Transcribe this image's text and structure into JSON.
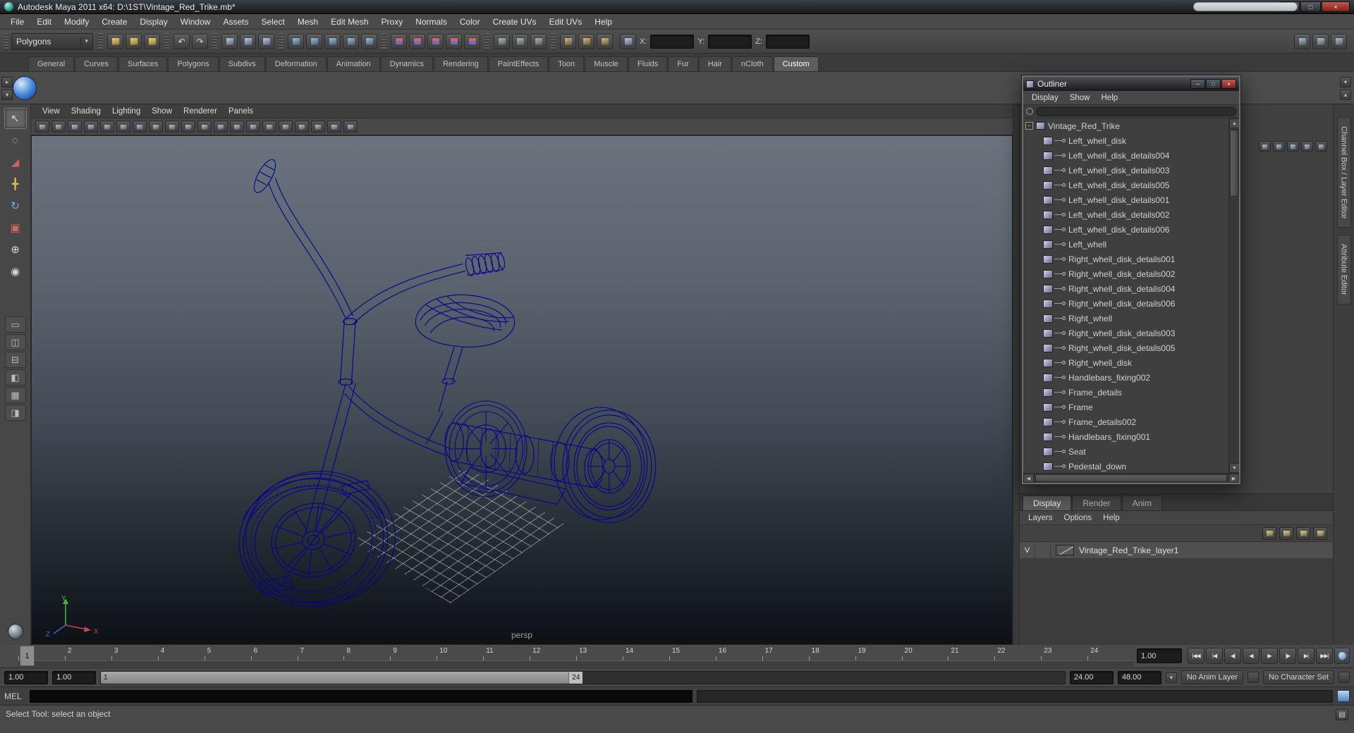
{
  "titlebar": {
    "title": "Autodesk Maya 2011 x64: D:\\1ST\\Vintage_Red_Trike.mb*"
  },
  "menubar": [
    "File",
    "Edit",
    "Modify",
    "Create",
    "Display",
    "Window",
    "Assets",
    "Select",
    "Mesh",
    "Edit Mesh",
    "Proxy",
    "Normals",
    "Color",
    "Create UVs",
    "Edit UVs",
    "Help"
  ],
  "statusline": {
    "mode_selector": "Polygons",
    "groups": [
      {
        "cls": "g-file",
        "icons": [
          {
            "n": "new-scene-icon"
          },
          {
            "n": "open-scene-icon"
          },
          {
            "n": "save-scene-icon"
          }
        ]
      },
      {
        "cls": "g-undo",
        "icons": [
          {
            "n": "undo-icon",
            "g": "↶"
          },
          {
            "n": "redo-icon",
            "g": "↷"
          }
        ]
      },
      {
        "cls": "g-mode",
        "icons": [
          {
            "n": "select-hierarchy-icon"
          },
          {
            "n": "select-object-icon"
          },
          {
            "n": "select-component-icon"
          }
        ]
      },
      {
        "cls": "g-mask",
        "icons": [
          {
            "n": "select-handles-icon"
          },
          {
            "n": "select-points-icon"
          },
          {
            "n": "select-curves-icon"
          },
          {
            "n": "select-surfaces-icon"
          },
          {
            "n": "select-rendering-icon"
          }
        ]
      },
      {
        "cls": "g-snap",
        "icons": [
          {
            "n": "snap-to-grids-icon"
          },
          {
            "n": "snap-to-curves-icon"
          },
          {
            "n": "snap-to-points-icon"
          },
          {
            "n": "snap-to-view-planes-icon"
          },
          {
            "n": "make-live-icon"
          }
        ]
      },
      {
        "cls": "g-hist",
        "icons": [
          {
            "n": "input-connections-icon"
          },
          {
            "n": "output-connections-icon"
          },
          {
            "n": "construction-history-icon"
          }
        ]
      },
      {
        "cls": "g-render",
        "icons": [
          {
            "n": "render-current-frame-icon"
          },
          {
            "n": "ipr-render-icon"
          },
          {
            "n": "render-settings-icon"
          }
        ]
      }
    ],
    "coord": {
      "x_label": "X:",
      "y_label": "Y:",
      "z_label": "Z:",
      "x_value": "",
      "y_value": "",
      "z_value": ""
    },
    "right_icons": [
      {
        "n": "show-channel-box-icon"
      },
      {
        "n": "show-tool-settings-icon"
      },
      {
        "n": "show-attribute-editor-icon"
      }
    ]
  },
  "shelf": {
    "tabs": [
      "General",
      "Curves",
      "Surfaces",
      "Polygons",
      "Subdivs",
      "Deformation",
      "Animation",
      "Dynamics",
      "Rendering",
      "PaintEffects",
      "Toon",
      "Muscle",
      "Fluids",
      "Fur",
      "Hair",
      "nCloth",
      "Custom"
    ],
    "active_tab": "Custom"
  },
  "toolbox": {
    "tools": [
      {
        "n": "select-tool",
        "g": "↖"
      },
      {
        "n": "lasso-select-tool",
        "g": "◌"
      },
      {
        "n": "paint-select-tool",
        "g": "◢"
      },
      {
        "n": "move-tool",
        "g": "╋"
      },
      {
        "n": "rotate-tool",
        "g": "↻"
      },
      {
        "n": "scale-tool",
        "g": "▣"
      },
      {
        "n": "universal-manipulator-tool",
        "g": "⊕"
      },
      {
        "n": "soft-modification-tool",
        "g": "◉"
      }
    ],
    "active_tool": "select-tool",
    "layouts": [
      {
        "n": "single-pane-layout",
        "g": "▭"
      },
      {
        "n": "two-panes-side-by-side-layout",
        "g": "◫"
      },
      {
        "n": "two-panes-stacked-layout",
        "g": "⊟"
      },
      {
        "n": "three-panes-layout",
        "g": "◧"
      },
      {
        "n": "four-panes-layout",
        "g": "▦"
      },
      {
        "n": "outliner-persp-layout",
        "g": "◨"
      }
    ]
  },
  "viewport": {
    "menus": [
      "View",
      "Shading",
      "Lighting",
      "Show",
      "Renderer",
      "Panels"
    ],
    "toolbar_icons": [
      "select-camera-icon",
      "camera-attributes-icon",
      "bookmark-icon",
      "image-plane-icon",
      "view-grid-icon",
      "film-gate-icon",
      "resolution-gate-icon",
      "gate-mask-icon",
      "field-chart-icon",
      "safe-action-icon",
      "safe-title-icon",
      "wireframe-mode-icon",
      "shaded-mode-icon",
      "textured-mode-icon",
      "use-all-lights-icon",
      "shadows-icon",
      "xray-icon",
      "isolate-select-icon",
      "frame-selected-icon",
      "frame-all-icon"
    ],
    "camera_label": "persp",
    "axis": {
      "x": "X",
      "y": "Y",
      "z": "Z"
    }
  },
  "outliner": {
    "title": "Outliner",
    "menus": [
      "Display",
      "Show",
      "Help"
    ],
    "root_item": "Vintage_Red_Trike",
    "items": [
      "Left_whell_disk",
      "Left_whell_disk_details004",
      "Left_whell_disk_details003",
      "Left_whell_disk_details005",
      "Left_whell_disk_details001",
      "Left_whell_disk_details002",
      "Left_whell_disk_details006",
      "Left_whell",
      "Right_whell_disk_details001",
      "Right_whell_disk_details002",
      "Right_whell_disk_details004",
      "Right_whell_disk_details006",
      "Right_whell",
      "Right_whell_disk_details003",
      "Right_whell_disk_details005",
      "Right_whell_disk",
      "Handlebars_fixing002",
      "Frame_details",
      "Frame",
      "Frame_details002",
      "Handlebars_fixing001",
      "Seat",
      "Pedestal_down"
    ]
  },
  "layer_editor": {
    "tabs": [
      "Display",
      "Render",
      "Anim"
    ],
    "active_tab": "Display",
    "menus": [
      "Layers",
      "Options",
      "Help"
    ],
    "icons": [
      "layers-options-icon",
      "transfer-attributes-icon",
      "new-empty-layer-icon",
      "new-layer-from-selected-icon"
    ],
    "layers": [
      {
        "visibility": "V",
        "name": "Vintage_Red_Trike_layer1"
      }
    ]
  },
  "right_tabs": [
    "Channel Box / Layer Editor",
    "Attribute Editor"
  ],
  "channel_box_icons": [
    "channel-manipulator-icon",
    "channel-speed-slow-icon",
    "channel-speed-medium-icon",
    "channel-speed-fast-icon",
    "channel-clamp-icon"
  ],
  "time_slider": {
    "ticks": [
      "1",
      "2",
      "3",
      "4",
      "5",
      "6",
      "7",
      "8",
      "9",
      "10",
      "11",
      "12",
      "13",
      "14",
      "15",
      "16",
      "17",
      "18",
      "19",
      "20",
      "21",
      "22",
      "23",
      "24"
    ],
    "current_frame": "1",
    "current_time": "1.00",
    "transport": [
      {
        "n": "go-to-start-button",
        "g": "|◀◀"
      },
      {
        "n": "step-back-one-key-button",
        "g": "|◀"
      },
      {
        "n": "step-back-one-frame-button",
        "g": "◀|"
      },
      {
        "n": "play-backwards-button",
        "g": "◀"
      },
      {
        "n": "play-forwards-button",
        "g": "▶"
      },
      {
        "n": "step-forward-one-frame-button",
        "g": "|▶"
      },
      {
        "n": "step-forward-one-key-button",
        "g": "▶|"
      },
      {
        "n": "go-to-end-button",
        "g": "▶▶|"
      }
    ]
  },
  "range_slider": {
    "anim_start": "1.00",
    "playback_start": "1.00",
    "bar_start_label": "1",
    "bar_end_label": "24",
    "playback_end": "24.00",
    "anim_end": "48.00",
    "anim_layer": "No Anim Layer",
    "character_set": "No Character Set"
  },
  "command_line": {
    "label": "MEL",
    "input_value": "",
    "result_value": ""
  },
  "help_line": {
    "text": "Select Tool: select an object"
  }
}
